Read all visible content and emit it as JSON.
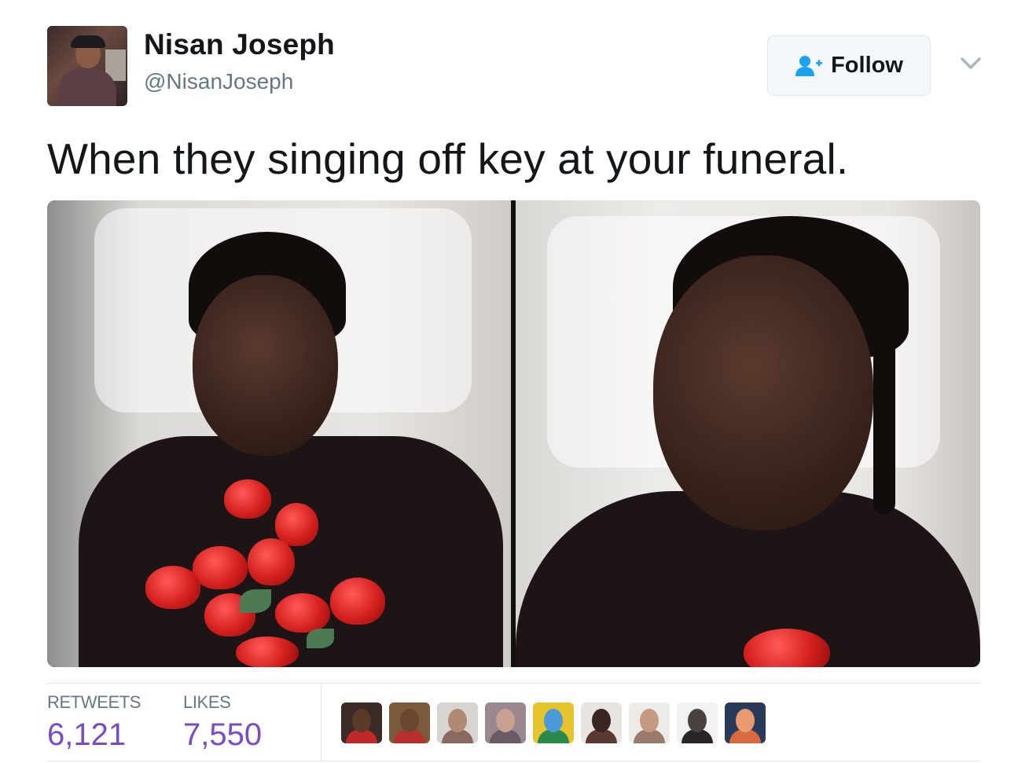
{
  "user": {
    "display_name": "Nisan Joseph",
    "handle": "@NisanJoseph",
    "avatar_icon": "profile-photo"
  },
  "follow_button": {
    "label": "Follow",
    "icon": "add-user-icon",
    "color": "#1da1f2"
  },
  "menu": {
    "icon": "chevron-down-icon"
  },
  "tweet": {
    "text": "When they singing off key at your funeral.",
    "media": {
      "panels": 2,
      "panel_icons": [
        "photo-man-lying-in-casket-eyes-closed",
        "photo-man-lying-in-casket-frowning"
      ]
    }
  },
  "stats": {
    "retweets_label": "RETWEETS",
    "retweets_value": "6,121",
    "likes_label": "LIKES",
    "likes_value": "7,550",
    "value_color": "#794bc4"
  },
  "likers": [
    {
      "avatar": "liker-avatar-1",
      "bg": "#3b2a25",
      "face": "#5a3a28",
      "body": "#c0282a"
    },
    {
      "avatar": "liker-avatar-2",
      "bg": "#7a5a3a",
      "face": "#6a4630",
      "body": "#b8302c"
    },
    {
      "avatar": "liker-avatar-3",
      "bg": "#d8d4d0",
      "face": "#b08a74",
      "body": "#8a6a60"
    },
    {
      "avatar": "liker-avatar-4",
      "bg": "#9a8890",
      "face": "#c8a090",
      "body": "#6a5a64"
    },
    {
      "avatar": "liker-avatar-5",
      "bg": "#e6c430",
      "face": "#4a9ad8",
      "body": "#2a8a4a"
    },
    {
      "avatar": "liker-avatar-6",
      "bg": "#e8e4e2",
      "face": "#3a2620",
      "body": "#5a3a30"
    },
    {
      "avatar": "liker-avatar-7",
      "bg": "#ecebe8",
      "face": "#c49a80",
      "body": "#9a7a6a"
    },
    {
      "avatar": "liker-avatar-8",
      "bg": "#f2f2f2",
      "face": "#4a4240",
      "body": "#2a2424"
    },
    {
      "avatar": "liker-avatar-9",
      "bg": "#2a3a5a",
      "face": "#e89a70",
      "body": "#d86a40"
    }
  ]
}
